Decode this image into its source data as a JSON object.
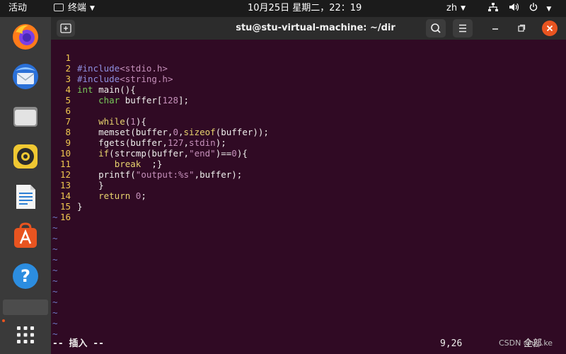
{
  "topbar": {
    "activities": "活动",
    "app_name": "终端",
    "clock": "10月25日 星期二，22：19",
    "language": "zh"
  },
  "dock": {
    "apps": [
      "firefox-icon",
      "thunderbird-icon",
      "files-icon",
      "rhythmbox-icon",
      "libreoffice-writer-icon",
      "software-center-icon",
      "help-icon",
      "app-grid-icon"
    ]
  },
  "window": {
    "title": "stu@stu-virtual-machine: ~/dir"
  },
  "editor": {
    "line_numbers": [
      "1",
      "2",
      "3",
      "4",
      "5",
      "6",
      "7",
      "8",
      "9",
      "10",
      "11",
      "12",
      "13",
      "14",
      "15",
      "16"
    ],
    "lines": [
      "#include<stdio.h>",
      "#include<string.h>",
      "int main(){",
      "    char buffer[128];",
      "",
      "    while(1){",
      "    memset(buffer,0,sizeof(buffer));",
      "    fgets(buffer,127,stdin);",
      "    if(strcmp(buffer,\"end\")==0){",
      "       break  ;}",
      "    printf(\"output:%s\",buffer);",
      "    }",
      "    return 0;",
      "}",
      "",
      ""
    ],
    "empty_marker": "~",
    "empty_line_count": 12
  },
  "statusbar": {
    "mode": "-- 插入 --",
    "cursor_position": "9,26",
    "scroll": "全部"
  },
  "watermark": "CSDN @u...ke",
  "colors": {
    "terminal_bg": "#300a24",
    "accent": "#e95420",
    "line_number": "#f0c850",
    "tilde": "#6f79c8"
  }
}
